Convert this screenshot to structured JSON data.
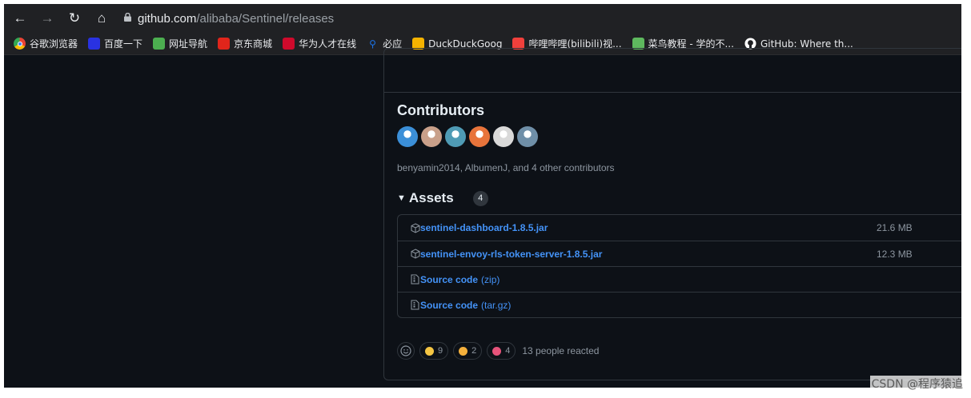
{
  "browser": {
    "url_host": "github.com",
    "url_path": "/alibaba/Sentinel/releases"
  },
  "bookmarks": [
    {
      "label": "谷歌浏览器",
      "icon": "chrome-icon",
      "color": "#4285f4"
    },
    {
      "label": "百度一下",
      "icon": "baidu-icon",
      "color": "#2932e1"
    },
    {
      "label": "网址导航",
      "icon": "home-icon",
      "color": "#4caf50"
    },
    {
      "label": "京东商城",
      "icon": "jd-icon",
      "color": "#e1251b"
    },
    {
      "label": "华为人才在线",
      "icon": "huawei-icon",
      "color": "#cf0a2c"
    },
    {
      "label": "必应",
      "icon": "search-icon",
      "color": "#1a73e8"
    },
    {
      "label": "DuckDuckGoog",
      "icon": "duck-icon",
      "color": "#f5b300"
    },
    {
      "label": "哔哩哔哩(bilibili)视...",
      "icon": "bilibili-icon",
      "color": "#f1403c"
    },
    {
      "label": "菜鸟教程 - 学的不...",
      "icon": "runoob-icon",
      "color": "#5eb95e"
    },
    {
      "label": "GitHub: Where th...",
      "icon": "github-icon",
      "color": "#ffffff"
    }
  ],
  "release": {
    "contributors_title": "Contributors",
    "contributors_text": "benyamin2014, AlbumenJ, and 4 other contributors",
    "avatar_colors": [
      "#3b8fd8",
      "#c9a08a",
      "#4f9bb5",
      "#e8743b",
      "#d9d9d9",
      "#6f8fa8"
    ],
    "assets_title": "Assets",
    "assets_count": "4",
    "assets": [
      {
        "name": "sentinel-dashboard-1.8.5.jar",
        "suffix": "",
        "size": "21.6 MB",
        "icon": "package-icon"
      },
      {
        "name": "sentinel-envoy-rls-token-server-1.8.5.jar",
        "suffix": "",
        "size": "12.3 MB",
        "icon": "package-icon"
      },
      {
        "name": "Source code",
        "suffix": "(zip)",
        "size": "",
        "icon": "file-zip-icon"
      },
      {
        "name": "Source code",
        "suffix": "(tar.gz)",
        "size": "",
        "icon": "file-zip-icon"
      }
    ],
    "reactions": [
      {
        "count": "9",
        "emoji": "thumbs-up-icon",
        "color": "#f4c543"
      },
      {
        "count": "2",
        "emoji": "laugh-icon",
        "color": "#f4b03c"
      },
      {
        "count": "4",
        "emoji": "rocket-icon",
        "color": "#e6537a"
      }
    ],
    "reactions_text": "13 people reacted"
  },
  "watermark": "CSDN @程序猿追"
}
